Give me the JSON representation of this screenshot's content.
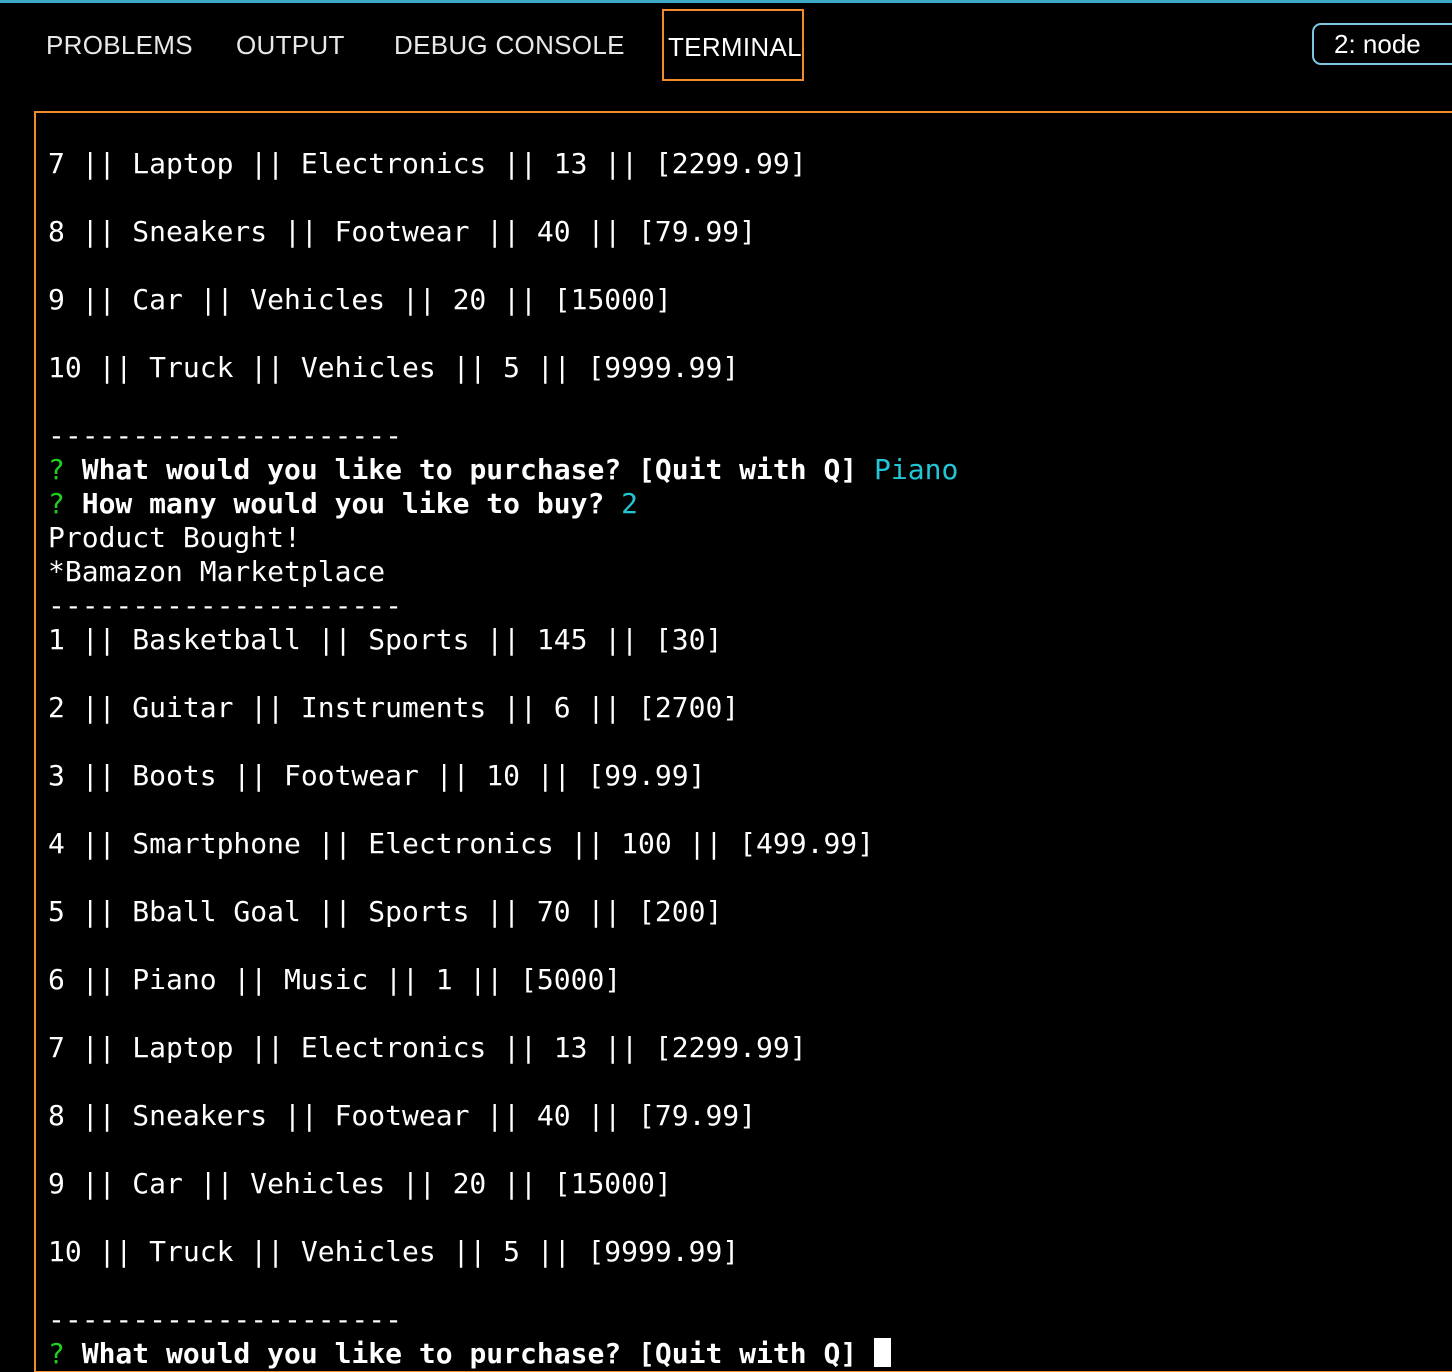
{
  "tabs": [
    {
      "label": "PROBLEMS",
      "active": false
    },
    {
      "label": "OUTPUT",
      "active": false
    },
    {
      "label": "DEBUG CONSOLE",
      "active": false
    },
    {
      "label": "TERMINAL",
      "active": true
    }
  ],
  "terminal_selector": {
    "value": "2: node"
  },
  "terminal": {
    "rows_top": [
      "7 || Laptop || Electronics || 13 || [2299.99]",
      "8 || Sneakers || Footwear || 40 || [79.99]",
      "9 || Car || Vehicles || 20 || [15000]",
      "10 || Truck || Vehicles || 5 || [9999.99]"
    ],
    "separator": "---------------------",
    "prompt_symbol": "?",
    "prompt_purchase": "What would you like to purchase? [Quit with Q]",
    "answer_purchase": "Piano",
    "prompt_quantity": "How many would you like to buy?",
    "answer_quantity": "2",
    "bought_message": "Product Bought!",
    "marketplace_title": "*Bamazon Marketplace",
    "rows_full": [
      "1 || Basketball || Sports || 145 || [30]",
      "2 || Guitar || Instruments || 6 || [2700]",
      "3 || Boots || Footwear || 10 || [99.99]",
      "4 || Smartphone || Electronics || 100 || [499.99]",
      "5 || Bball Goal || Sports || 70 || [200]",
      "6 || Piano || Music || 1 || [5000]",
      "7 || Laptop || Electronics || 13 || [2299.99]",
      "8 || Sneakers || Footwear || 40 || [79.99]",
      "9 || Car || Vehicles || 20 || [15000]",
      "10 || Truck || Vehicles || 5 || [9999.99]"
    ]
  },
  "colors": {
    "background": "#000000",
    "accent_orange": "#f08c2c",
    "prompt_green": "#1fcf1f",
    "answer_cyan": "#23c6d4",
    "top_border_blue": "#3fa9c9"
  }
}
